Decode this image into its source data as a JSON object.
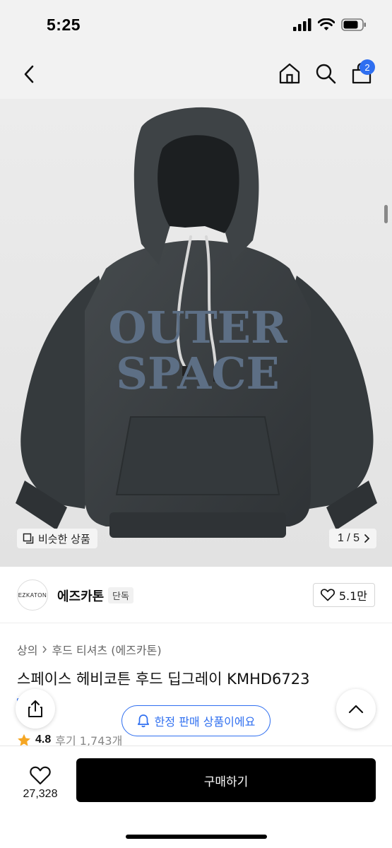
{
  "status_bar": {
    "time": "5:25"
  },
  "header": {
    "cart_count": "2",
    "icons": [
      "back-icon",
      "home-icon",
      "search-icon",
      "cart-icon"
    ]
  },
  "hero": {
    "print_line1": "OUTER",
    "print_line2": "SPACE",
    "similar_label": "비슷한 상품",
    "counter": "1 / 5"
  },
  "brand": {
    "logo_text": "EZKATON",
    "name": "에즈카톤",
    "tag": "단독",
    "likes": "5.1만"
  },
  "product": {
    "breadcrumb": [
      "상의",
      "후드 티셔츠 (에즈카톤)"
    ],
    "title": "스페이스 헤비코튼 후드 딥그레이 KMHD6723",
    "rating": "4.8",
    "reviews": "후기 1,743개"
  },
  "floating": {
    "limited_label": "한정 판매 상품이에요"
  },
  "bottom": {
    "wish_count": "27,328",
    "buy_label": "구매하기"
  },
  "colors": {
    "accent": "#2f6ff0",
    "hoodie": "#3b3f42",
    "print": "#5d6f85",
    "buy_button": "#000000"
  }
}
